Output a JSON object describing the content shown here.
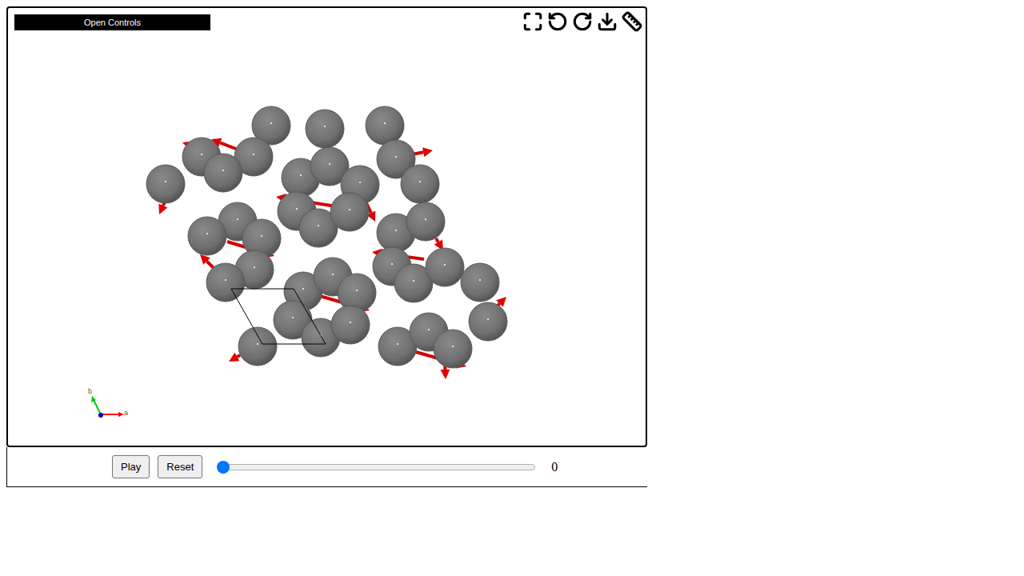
{
  "controls_toggle": {
    "label": "Open Controls"
  },
  "axes": [
    {
      "label": "a",
      "color": "#ff0000"
    },
    {
      "label": "b",
      "color": "#00cc00"
    }
  ],
  "buttons": [
    "Play",
    "Reset"
  ],
  "frame_slider": {
    "level": 0,
    "reading": "0"
  }
}
